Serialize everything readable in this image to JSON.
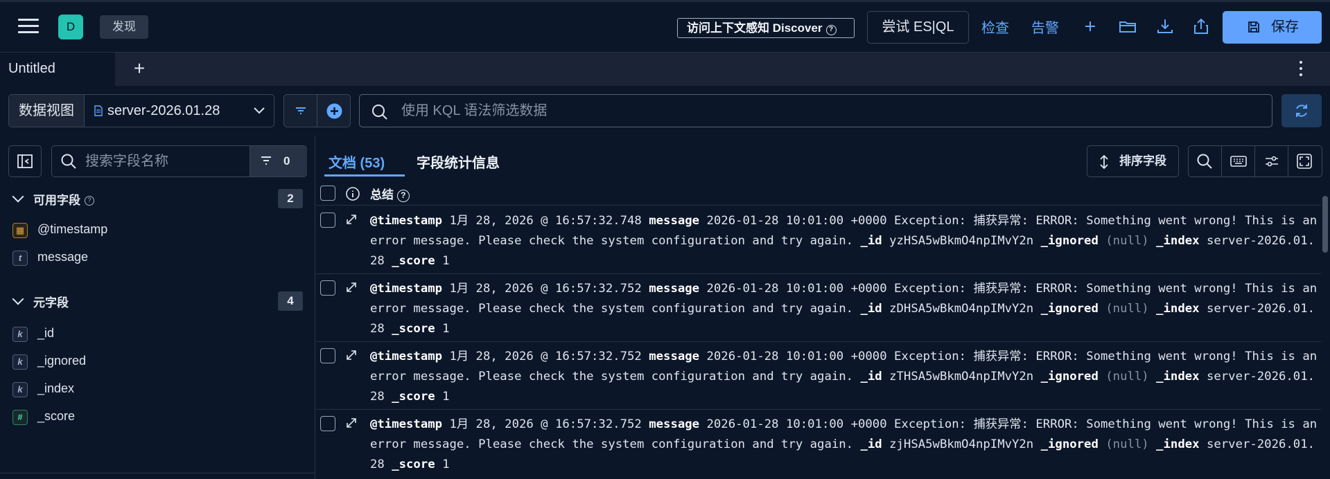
{
  "header": {
    "space_badge": "D",
    "breadcrumb": "发现",
    "context_button": "访问上下文感知 Discover",
    "esql_button": "尝试 ES|QL",
    "inspect_link": "检查",
    "alerts_link": "告警",
    "save_button": "保存"
  },
  "tabs": {
    "active": "Untitled",
    "add": "+"
  },
  "filters": {
    "data_view_label": "数据视图",
    "data_view_value": "server-2026.01.28",
    "kql_placeholder": "使用 KQL 语法筛选数据"
  },
  "sidebar": {
    "search_placeholder": "搜索字段名称",
    "filter_count": "0",
    "available": {
      "title": "可用字段",
      "count": "2",
      "fields": [
        {
          "name": "@timestamp",
          "type": "date"
        },
        {
          "name": "message",
          "type": "text"
        }
      ]
    },
    "meta": {
      "title": "元字段",
      "count": "4",
      "fields": [
        {
          "name": "_id",
          "type": "keyword"
        },
        {
          "name": "_ignored",
          "type": "keyword"
        },
        {
          "name": "_index",
          "type": "keyword"
        },
        {
          "name": "_score",
          "type": "number"
        }
      ]
    }
  },
  "main": {
    "docs_tab": "文档 (53)",
    "stats_tab": "字段统计信息",
    "sort_button": "排序字段",
    "summary_header": "总结",
    "rows": [
      {
        "ts": "1月 28, 2026 @ 16:57:32.748",
        "message": "2026-01-28 10:01:00 +0000 Exception: 捕获异常: ERROR: Something went wrong! This is an error message. Please check the system configuration and try again.",
        "id": "yzHSA5wBkmO4npIMvY2n",
        "ignored": "(null)",
        "index": "server-2026.01.28",
        "score": "1"
      },
      {
        "ts": "1月 28, 2026 @ 16:57:32.752",
        "message": "2026-01-28 10:01:00 +0000 Exception: 捕获异常: ERROR: Something went wrong! This is an error message. Please check the system configuration and try again.",
        "id": "zDHSA5wBkmO4npIMvY2n",
        "ignored": "(null)",
        "index": "server-2026.01.28",
        "score": "1"
      },
      {
        "ts": "1月 28, 2026 @ 16:57:32.752",
        "message": "2026-01-28 10:01:00 +0000 Exception: 捕获异常: ERROR: Something went wrong! This is an error message. Please check the system configuration and try again.",
        "id": "zTHSA5wBkmO4npIMvY2n",
        "ignored": "(null)",
        "index": "server-2026.01.28",
        "score": "1"
      },
      {
        "ts": "1月 28, 2026 @ 16:57:32.752",
        "message": "2026-01-28 10:01:00 +0000 Exception: 捕获异常: ERROR: Something went wrong! This is an error message. Please check the system configuration and try again.",
        "id": "zjHSA5wBkmO4npIMvY2n",
        "ignored": "(null)",
        "index": "server-2026.01.28",
        "score": "1"
      }
    ],
    "labels": {
      "timestamp": "@timestamp",
      "message": "message",
      "id": "_id",
      "ignored": "_ignored",
      "index": "_index",
      "score": "_score"
    }
  },
  "colors": {
    "accent": "#62a8ff",
    "save_bg": "#61a2ff",
    "space_badge": "#24c2b0",
    "background": "#0b1628"
  }
}
